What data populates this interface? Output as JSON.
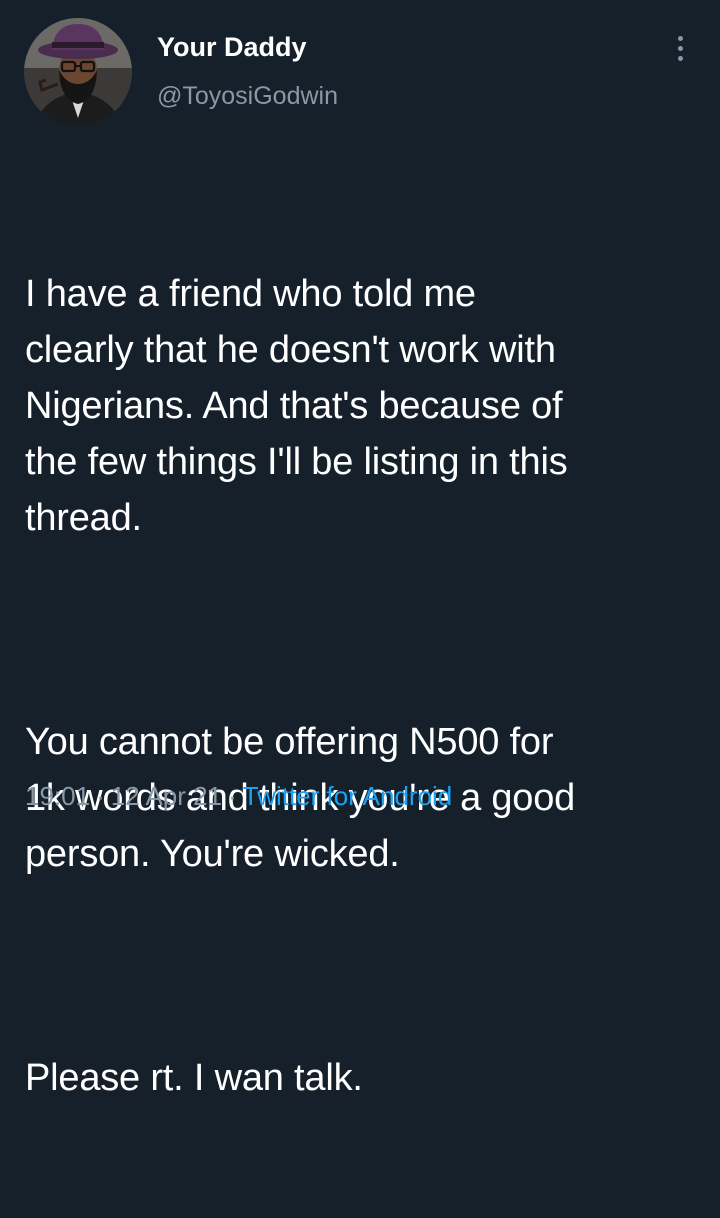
{
  "tweet": {
    "author": {
      "display_name": "Your Daddy",
      "handle": "@ToyosiGodwin",
      "avatar_icon": "profile-photo"
    },
    "more_icon": "more-vertical-icon",
    "paragraphs": [
      "I have a friend who told me\nclearly that he doesn't work with\nNigerians. And that's because of\nthe few things I'll be listing in this\nthread.",
      "You cannot be offering N500 for\n1k words and think you're a good\nperson. You're wicked.",
      "Please rt. I wan talk."
    ],
    "time": "19:01",
    "separator_1": "·",
    "date": "12 Apr 21",
    "separator_2": "·",
    "source": "Twitter for Android"
  },
  "colors": {
    "background": "#15202b",
    "text_primary": "#ffffff",
    "text_secondary": "#8899a6",
    "link": "#1da1f2"
  }
}
